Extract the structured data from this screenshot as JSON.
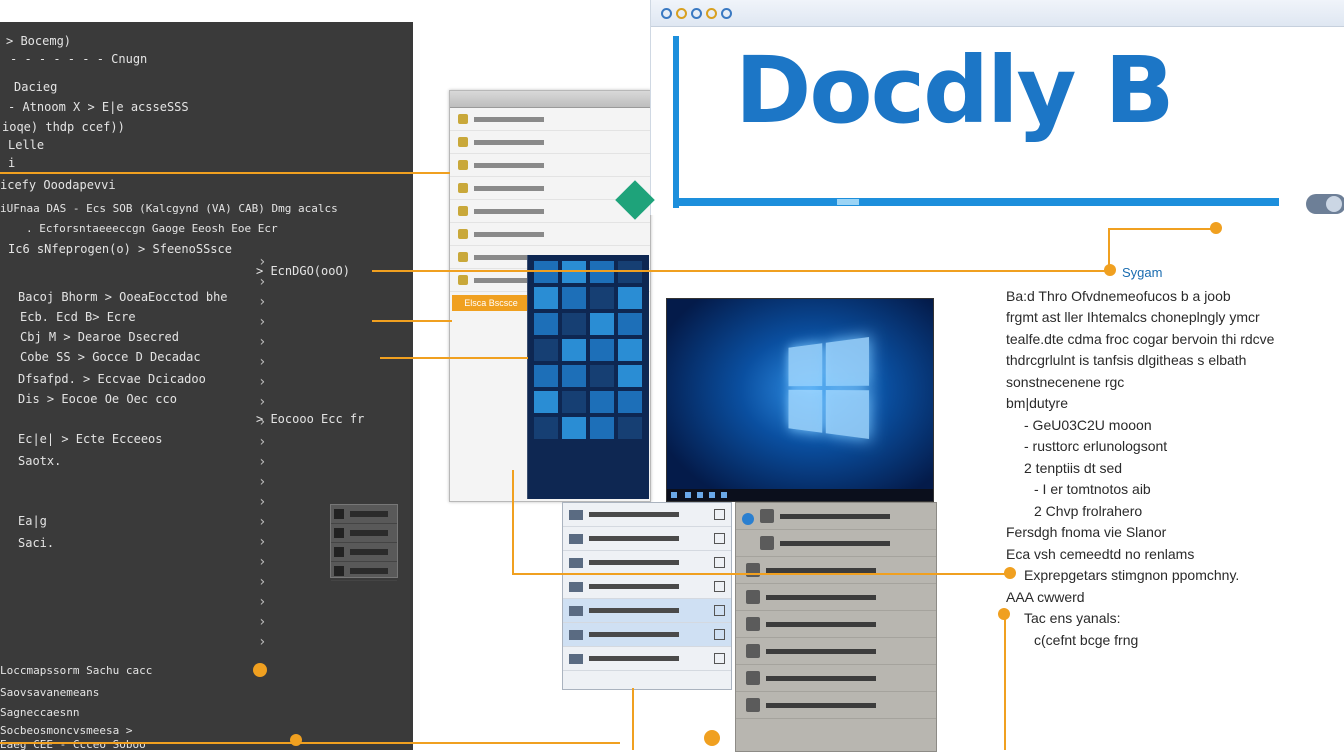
{
  "code_panel": {
    "lines": [
      "> Bocemg)",
      "- - - - - -  - Cnugn",
      "Dacieg",
      "- Atnoom  X  > E|e  acsseSSS",
      "ioqe) thdp ccef))",
      "Lelle",
      "i",
      "icefy Ooodapevvi",
      "iUFnaa DAS - Ecs SOB (Kalcgynd (VA) CAB) Dmg acalcs",
      ". Ecforsntaeeeccgn Gaoge Eeosh Eoe Ecr",
      "Ic6 sNfeprogen(o)   > SfeenoSSsce",
      "> EcnDGO(ooO)",
      "Bacoj Bhorm   > OoeaEocctod bhe",
      "Ecb.   Ecd B>  Ecre",
      "Cbj M   > Dearoe   Dsecred",
      "Cobe SS   > Gocce D   Decadac",
      "Dfsafpd.   > Eccvae Dcicadoo",
      "Dis   > Eocoe Oe  Oec cco",
      "  > Eocooo Ecc fr",
      "Ec|e|   > Ecte  Ecceeos",
      "Saotx.",
      "Ea|g",
      "Saci.",
      "Loccmapssorm Sachu  cacc",
      "Saovsavanemeans",
      "Sagneccaesnn",
      "Socbeosmoncvsmeesa  >",
      "Eaeg  CEE  - Ccceo Soboo"
    ]
  },
  "explorer": {
    "selected_label": "Elsca Bscsce"
  },
  "doc_window": {
    "headline": "Docdly B"
  },
  "text_block": {
    "section_title": "Sygam",
    "paragraph": [
      "Ba:d Thro Ofvdnemeofucos b a joob",
      "frgmt ast ller Ihtemalcs choneplngly ymcr",
      "tealfe.dte cdma froc cogar bervoin thi rdcve",
      "thdrcgrlulnt is tanfsis dlgitheas s elbath",
      "sonstnecenene rgc",
      "bm|dutyre"
    ],
    "bullets_a": [
      "- GeU03C2U mooon",
      "- rusttorc erlunologsont",
      "2 tenptiis dt sed",
      "- I er tomtnotos aib",
      "2 Chvp frolrahero"
    ],
    "lines_b": [
      "Fersdgh fnoma vie Slanor",
      "Eca vsh cemeedtd no renlams"
    ],
    "bullets_c": [
      "Exprepgetars stimgnon ppomchny.",
      "AAA cwwerd",
      "Tac ens yanals:",
      "c(cefnt bcge frng"
    ]
  }
}
